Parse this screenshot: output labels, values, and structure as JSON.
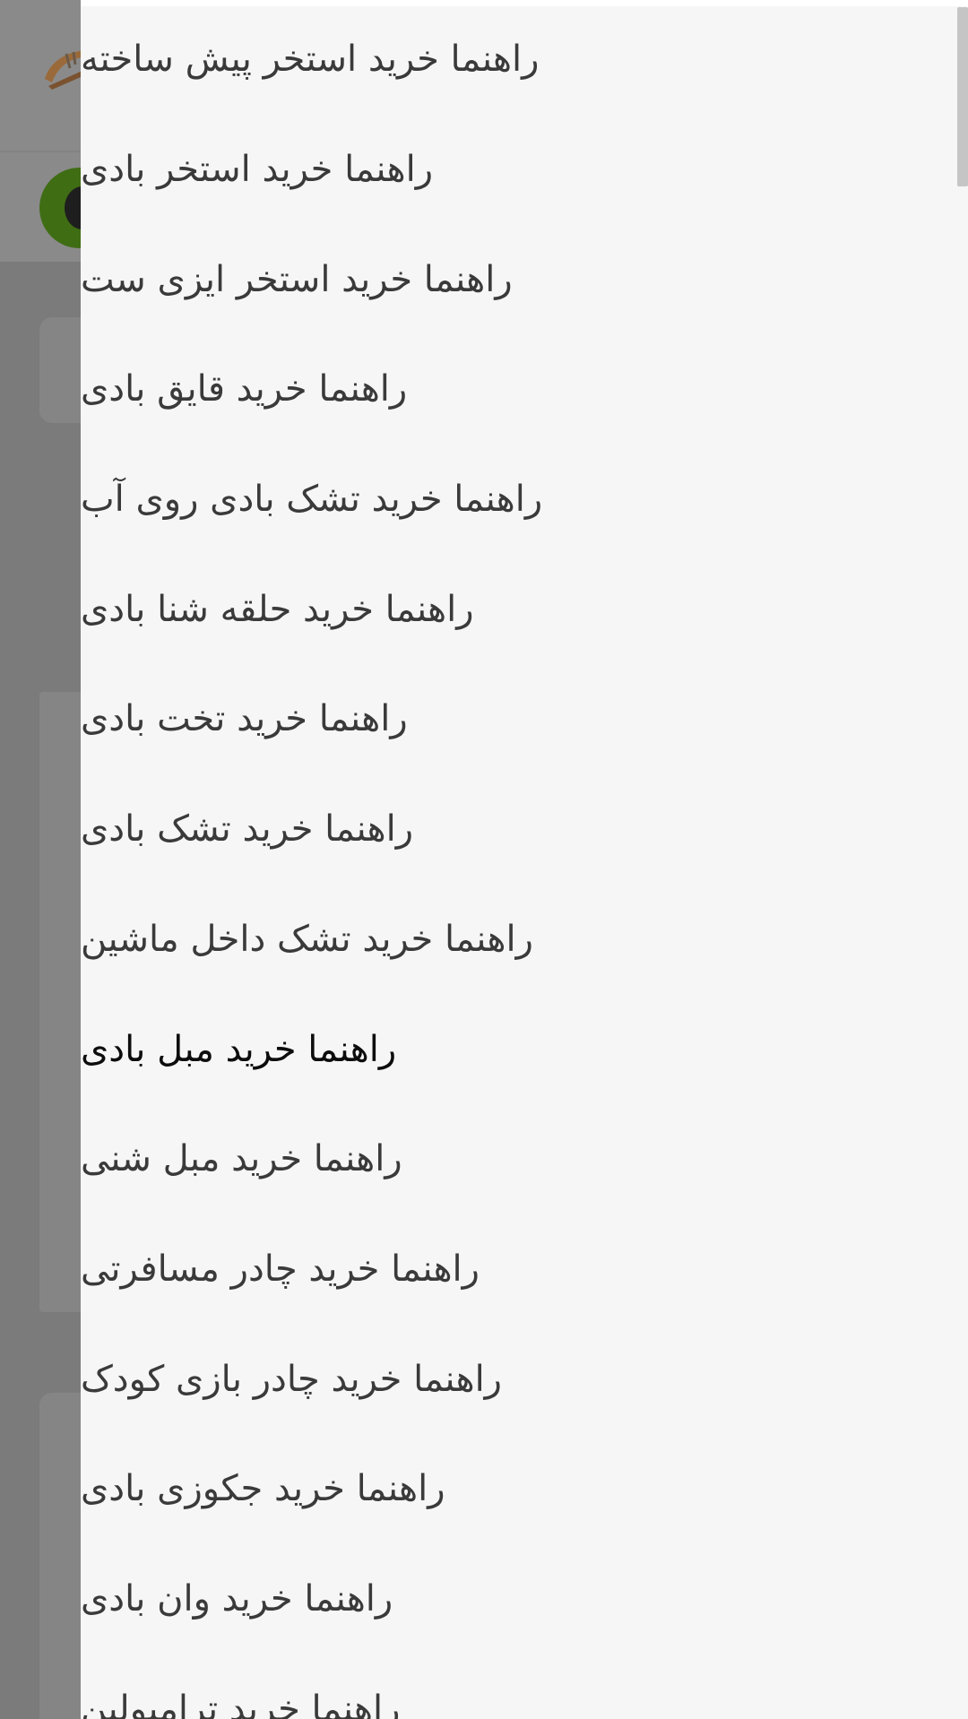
{
  "drawer": {
    "items": [
      {
        "label": "راهنما خرید استخر پیش ساخته"
      },
      {
        "label": "راهنما خرید استخر بادی"
      },
      {
        "label": "راهنما خرید استخر ایزی ست"
      },
      {
        "label": "راهنما خرید قایق بادی"
      },
      {
        "label": "راهنما خرید تشک بادی روی آب"
      },
      {
        "label": "راهنما خرید حلقه شنا بادی"
      },
      {
        "label": "راهنما خرید تخت بادی"
      },
      {
        "label": "راهنما خرید تشک بادی"
      },
      {
        "label": "راهنما خرید تشک داخل ماشین"
      },
      {
        "label": "راهنما خرید مبل بادی"
      },
      {
        "label": "راهنما خرید مبل شنی"
      },
      {
        "label": "راهنما خرید چادر مسافرتی"
      },
      {
        "label": "راهنما خرید چادر بازی کودک"
      },
      {
        "label": "راهنما خرید جکوزی بادی"
      },
      {
        "label": "راهنما خرید وان بادی"
      },
      {
        "label": "راهنما خرید ترامپولین"
      }
    ]
  },
  "colors": {
    "drawer_background": "#f6f6f6",
    "overlay": "#7b7b7b",
    "text": "#3a3a3a",
    "avatar": "#3f6d14"
  }
}
